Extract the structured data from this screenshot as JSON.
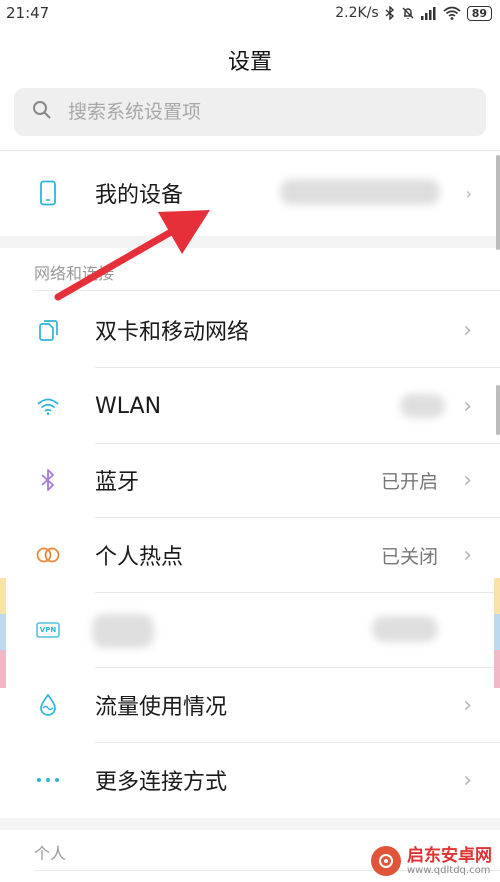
{
  "status_bar": {
    "time": "21:47",
    "speed": "2.2K/s",
    "battery": "89"
  },
  "header": {
    "title": "设置"
  },
  "search": {
    "placeholder": "搜索系统设置项"
  },
  "device_row": {
    "label": "我的设备"
  },
  "network_section": {
    "title": "网络和连接",
    "items": [
      {
        "label": "双卡和移动网络",
        "value": "",
        "icon": "sim-cards-icon"
      },
      {
        "label": "WLAN",
        "value": "",
        "icon": "wifi-icon"
      },
      {
        "label": "蓝牙",
        "value": "已开启",
        "icon": "bluetooth-icon"
      },
      {
        "label": "个人热点",
        "value": "已关闭",
        "icon": "hotspot-icon"
      },
      {
        "label": "",
        "value": "",
        "icon": "vpn-icon"
      },
      {
        "label": "流量使用情况",
        "value": "",
        "icon": "data-usage-icon"
      },
      {
        "label": "更多连接方式",
        "value": "",
        "icon": "more-icon"
      }
    ]
  },
  "personal_section": {
    "title": "个人"
  },
  "vpn_icon_text": "VPN",
  "watermark": {
    "name": "启东安卓网",
    "url": "www.qdltdq.com"
  },
  "colors": {
    "accent": "#2bb5d8",
    "arrow": "#e5303a",
    "bluetooth": "#a67bdc",
    "hotspot": "#f0873b"
  }
}
